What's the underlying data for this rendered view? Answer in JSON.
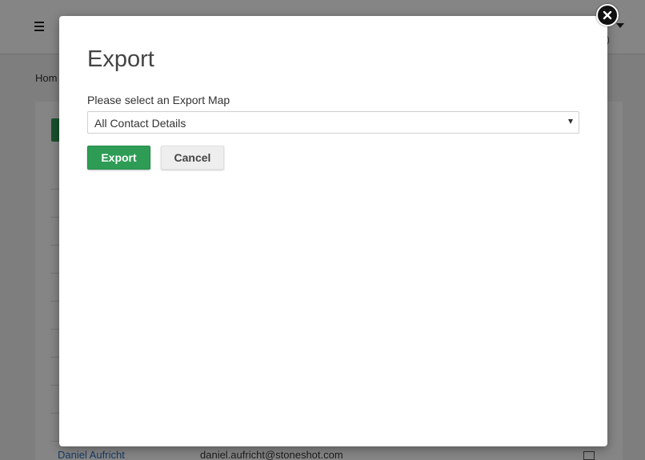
{
  "background": {
    "breadcrumb": "Hom",
    "top_sub": "g)",
    "contact_name": "Daniel Aufricht",
    "contact_email": "daniel.aufricht@stoneshot.com"
  },
  "modal": {
    "title": "Export",
    "field_label": "Please select an Export Map",
    "selected_map": "All Contact Details",
    "export_label": "Export",
    "cancel_label": "Cancel"
  },
  "colors": {
    "accent": "#2e9c55",
    "cancel_bg": "#eeeeee"
  },
  "icons": {
    "close": "close-icon",
    "menu": "menu-icon",
    "dropdown": "caret-down-icon",
    "mail": "mail-icon"
  }
}
